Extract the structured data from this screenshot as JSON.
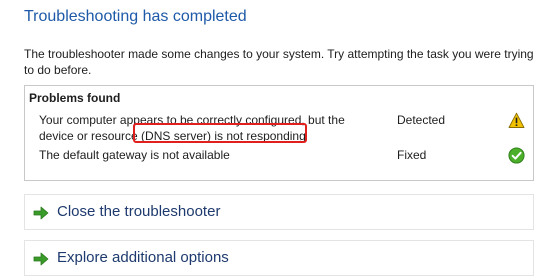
{
  "header": {
    "title": "Troubleshooting has completed",
    "description": "The troubleshooter made some changes to your system. Try attempting the task you were trying to do before."
  },
  "problems": {
    "heading": "Problems found",
    "items": [
      {
        "issue": "Your computer appears to be correctly configured, but the device or resource (DNS server) is not responding",
        "status": "Detected",
        "icon": "warning-icon"
      },
      {
        "issue": "The default gateway is not available",
        "status": "Fixed",
        "icon": "check-icon"
      }
    ],
    "highlight_color": "#e0201e"
  },
  "options": [
    {
      "label": "Close the troubleshooter",
      "icon": "green-arrow-icon"
    },
    {
      "label": "Explore additional options",
      "icon": "green-arrow-icon"
    }
  ],
  "colors": {
    "title": "#1e5aa8",
    "option_text": "#1e3a6e",
    "arrow": "#3a9a2a",
    "warning": "#f2c200",
    "check": "#4caf2a"
  }
}
